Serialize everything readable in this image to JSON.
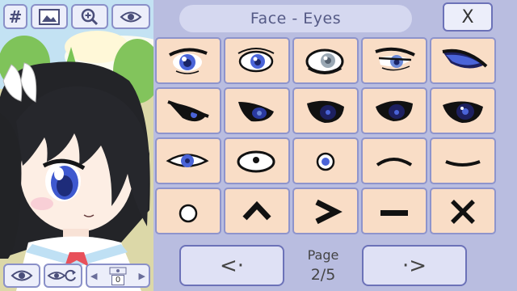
{
  "toolbar": {
    "hash_label": "#",
    "icons": [
      "image-icon",
      "zoom-in-icon",
      "eye-icon"
    ]
  },
  "bottom_controls": {
    "icons": [
      "eye-icon",
      "eye-reset-icon",
      "layer-select"
    ],
    "layer_value": "0"
  },
  "panel": {
    "title": "Face - Eyes",
    "close_label": "X",
    "page_word": "Page",
    "page_number": "2/5",
    "prev_label": "<·",
    "next_label": "·>"
  },
  "eye_options": [
    "eye-style-1",
    "eye-style-2",
    "eye-style-3",
    "eye-style-4",
    "eye-style-5",
    "eye-style-6",
    "eye-style-7",
    "eye-style-8",
    "eye-style-9",
    "eye-style-10",
    "eye-style-11",
    "eye-style-12",
    "eye-style-13",
    "eye-style-14",
    "eye-style-15",
    "circle-eye",
    "caret-up-eye",
    "greater-than-eye",
    "dash-eye",
    "x-eye"
  ],
  "colors": {
    "panel_bg": "#b9bde0",
    "cell_bg": "#f9ddc6",
    "cell_border": "#8e94cc",
    "iris_blue": "#4a64d8",
    "hair": "#222326"
  }
}
